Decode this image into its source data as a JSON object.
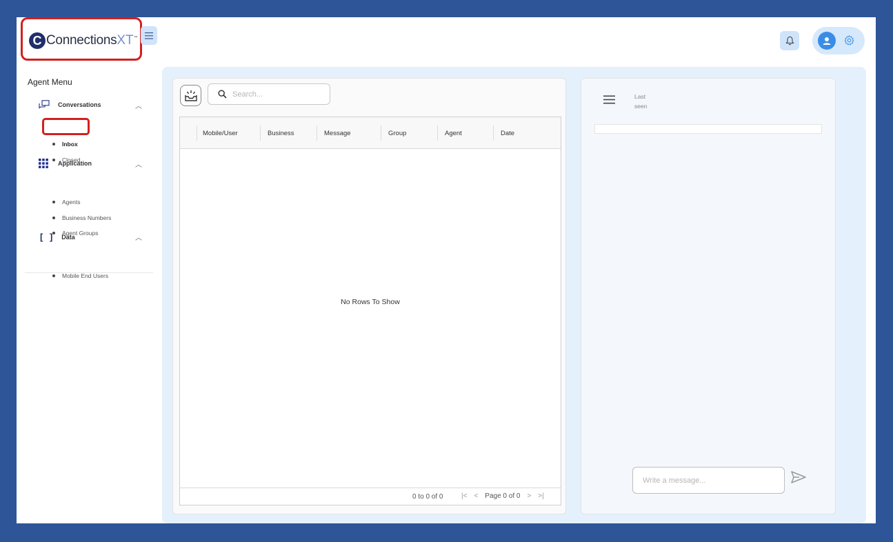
{
  "header": {
    "logo_letter": "C",
    "logo_text": "Connections",
    "logo_suffix": "XT",
    "logo_tm": "™"
  },
  "sidebar": {
    "title": "Agent Menu",
    "sections": [
      {
        "label": "Conversations",
        "icon": "chat-bubbles-icon",
        "items": [
          "Inbox",
          "Closed"
        ]
      },
      {
        "label": "Application",
        "icon": "grid-apps-icon",
        "items": [
          "Agents",
          "Business Numbers",
          "Agent Groups"
        ]
      },
      {
        "label": "Data",
        "icon": "brackets-icon",
        "items": [
          "Mobile End Users"
        ]
      }
    ],
    "active_item": "Inbox"
  },
  "inbox": {
    "search_placeholder": "Search...",
    "columns": [
      "Mobile/User",
      "Business",
      "Message",
      "Group",
      "Agent",
      "Date"
    ],
    "empty_text": "No Rows To Show",
    "row_count": "0 to 0 of 0",
    "page_text": "Page 0 of 0"
  },
  "chat": {
    "last_seen": "Last seen",
    "message_placeholder": "Write a message..."
  },
  "colors": {
    "frame": "#2e5597",
    "accent": "#3a8de6",
    "highlight": "#d21f1f",
    "content_bg": "#e4f0fc"
  }
}
